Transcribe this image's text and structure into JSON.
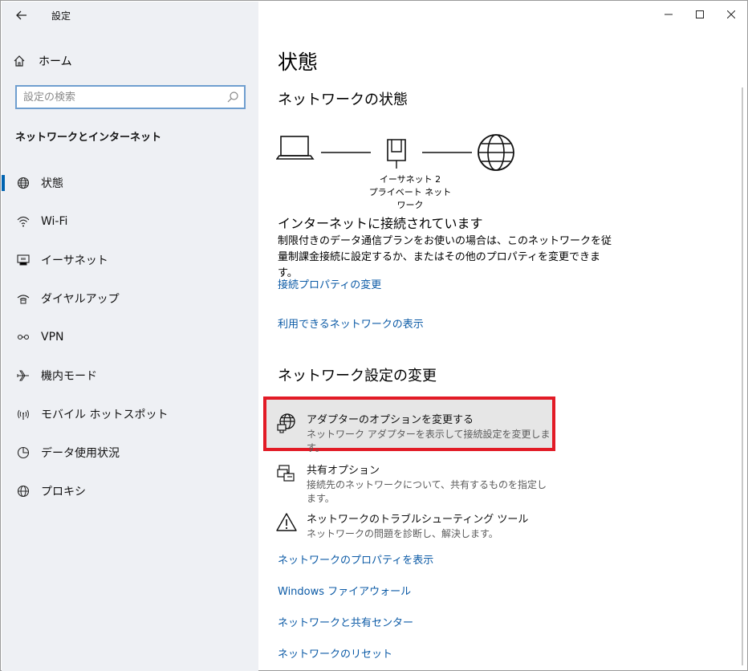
{
  "window": {
    "title": "設定"
  },
  "titlebar": {
    "minimize_glyph": "—",
    "maximize_glyph": "☐",
    "close_glyph": "✕"
  },
  "sidebar": {
    "home_label": "ホーム",
    "search_placeholder": "設定の検索",
    "section_heading": "ネットワークとインターネット",
    "items": [
      {
        "label": "状態",
        "icon": "globe-icon",
        "selected": true
      },
      {
        "label": "Wi-Fi",
        "icon": "wifi-icon"
      },
      {
        "label": "イーサネット",
        "icon": "ethernet-icon"
      },
      {
        "label": "ダイヤルアップ",
        "icon": "dialup-icon"
      },
      {
        "label": "VPN",
        "icon": "vpn-icon"
      },
      {
        "label": "機内モード",
        "icon": "airplane-icon"
      },
      {
        "label": "モバイル ホットスポット",
        "icon": "hotspot-icon"
      },
      {
        "label": "データ使用状況",
        "icon": "data-usage-icon"
      },
      {
        "label": "プロキシ",
        "icon": "globe-icon"
      }
    ]
  },
  "main": {
    "title": "状態",
    "network_status_heading": "ネットワークの状態",
    "diagram": {
      "adapter_name": "イーサネット 2",
      "network_type": "プライベート ネットワーク"
    },
    "connection_status": "インターネットに接続されています",
    "connection_desc": "制限付きのデータ通信プランをお使いの場合は、このネットワークを従量制課金接続に設定するか、またはその他のプロパティを変更できます。",
    "links_top": [
      "接続プロパティの変更",
      "利用できるネットワークの表示"
    ],
    "change_settings_heading": "ネットワーク設定の変更",
    "options": [
      {
        "title": "アダプターのオプションを変更する",
        "desc": "ネットワーク アダプターを表示して接続設定を変更します。",
        "icon": "adapter-globe-icon",
        "highlighted": true
      },
      {
        "title": "共有オプション",
        "desc": "接続先のネットワークについて、共有するものを指定します。",
        "icon": "sharing-icon"
      },
      {
        "title": "ネットワークのトラブルシューティング ツール",
        "desc": "ネットワークの問題を診断し、解決します。",
        "icon": "warning-icon"
      }
    ],
    "links_bottom": [
      "ネットワークのプロパティを表示",
      "Windows ファイアウォール",
      "ネットワークと共有センター",
      "ネットワークのリセット"
    ]
  },
  "colors": {
    "accent": "#0063b1",
    "link": "#0b5aa6",
    "highlight_border": "#e21b26",
    "sidebar_bg": "#eef0f4"
  }
}
